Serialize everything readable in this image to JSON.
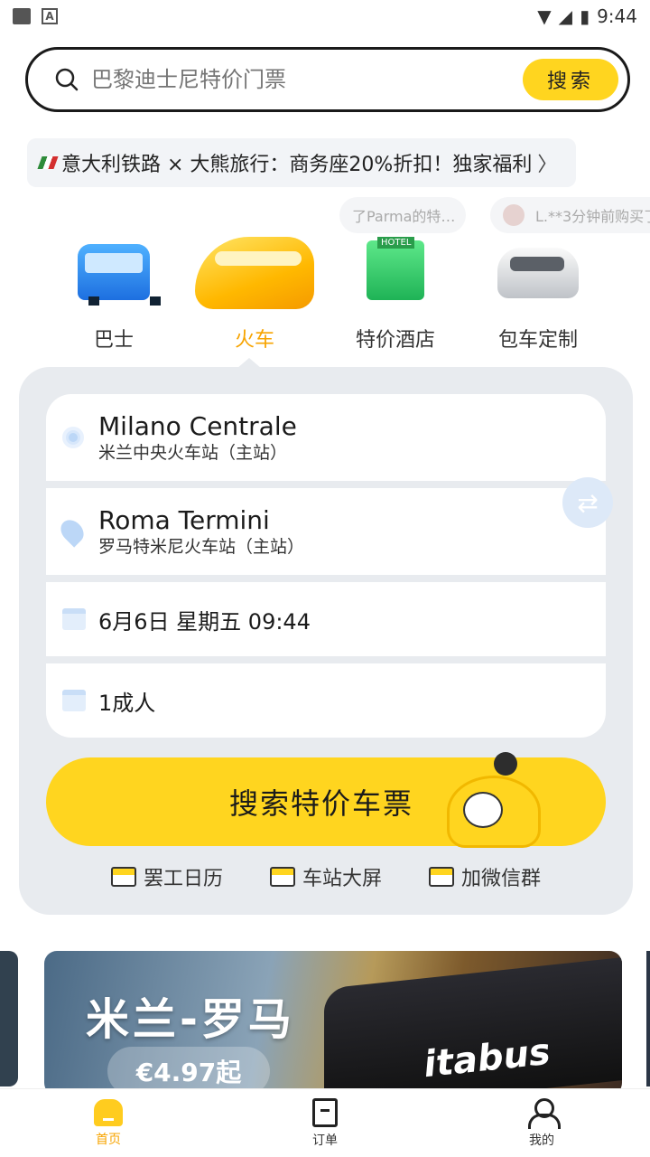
{
  "status_bar": {
    "time": "9:44"
  },
  "search": {
    "placeholder": "巴黎迪士尼特价门票",
    "button_label": "搜索"
  },
  "promo": {
    "text": "意大利铁路 × 大熊旅行：商务座20%折扣！独家福利",
    "chevron": "〉"
  },
  "tickers": [
    {
      "text": "了Parma的特…"
    },
    {
      "text": "L.**3分钟前购买了"
    }
  ],
  "categories": [
    {
      "label": "巴士",
      "icon": "bus-icon"
    },
    {
      "label": "火车",
      "icon": "train-icon",
      "active": true
    },
    {
      "label": "特价酒店",
      "icon": "hotel-icon"
    },
    {
      "label": "包车定制",
      "icon": "car-icon"
    }
  ],
  "booking": {
    "from": {
      "name": "Milano Centrale",
      "subtitle": "米兰中央火车站（主站）"
    },
    "to": {
      "name": "Roma Termini",
      "subtitle": "罗马特米尼火车站（主站）"
    },
    "date": "6月6日 星期五  09:44",
    "passengers": "1成人",
    "search_button": "搜索特价车票",
    "quick_links": [
      "罢工日历",
      "车站大屏",
      "加微信群"
    ]
  },
  "carousel": {
    "banner_title": "米兰-罗马",
    "banner_price": "€4.97起",
    "banner_brand": "itabus"
  },
  "bottom_nav": [
    {
      "label": "首页",
      "icon": "home-icon",
      "active": true
    },
    {
      "label": "订单",
      "icon": "order-icon"
    },
    {
      "label": "我的",
      "icon": "me-icon"
    }
  ],
  "colors": {
    "accent": "#ffd51f",
    "active_text": "#f7a400",
    "card_bg": "#e8ebef"
  }
}
